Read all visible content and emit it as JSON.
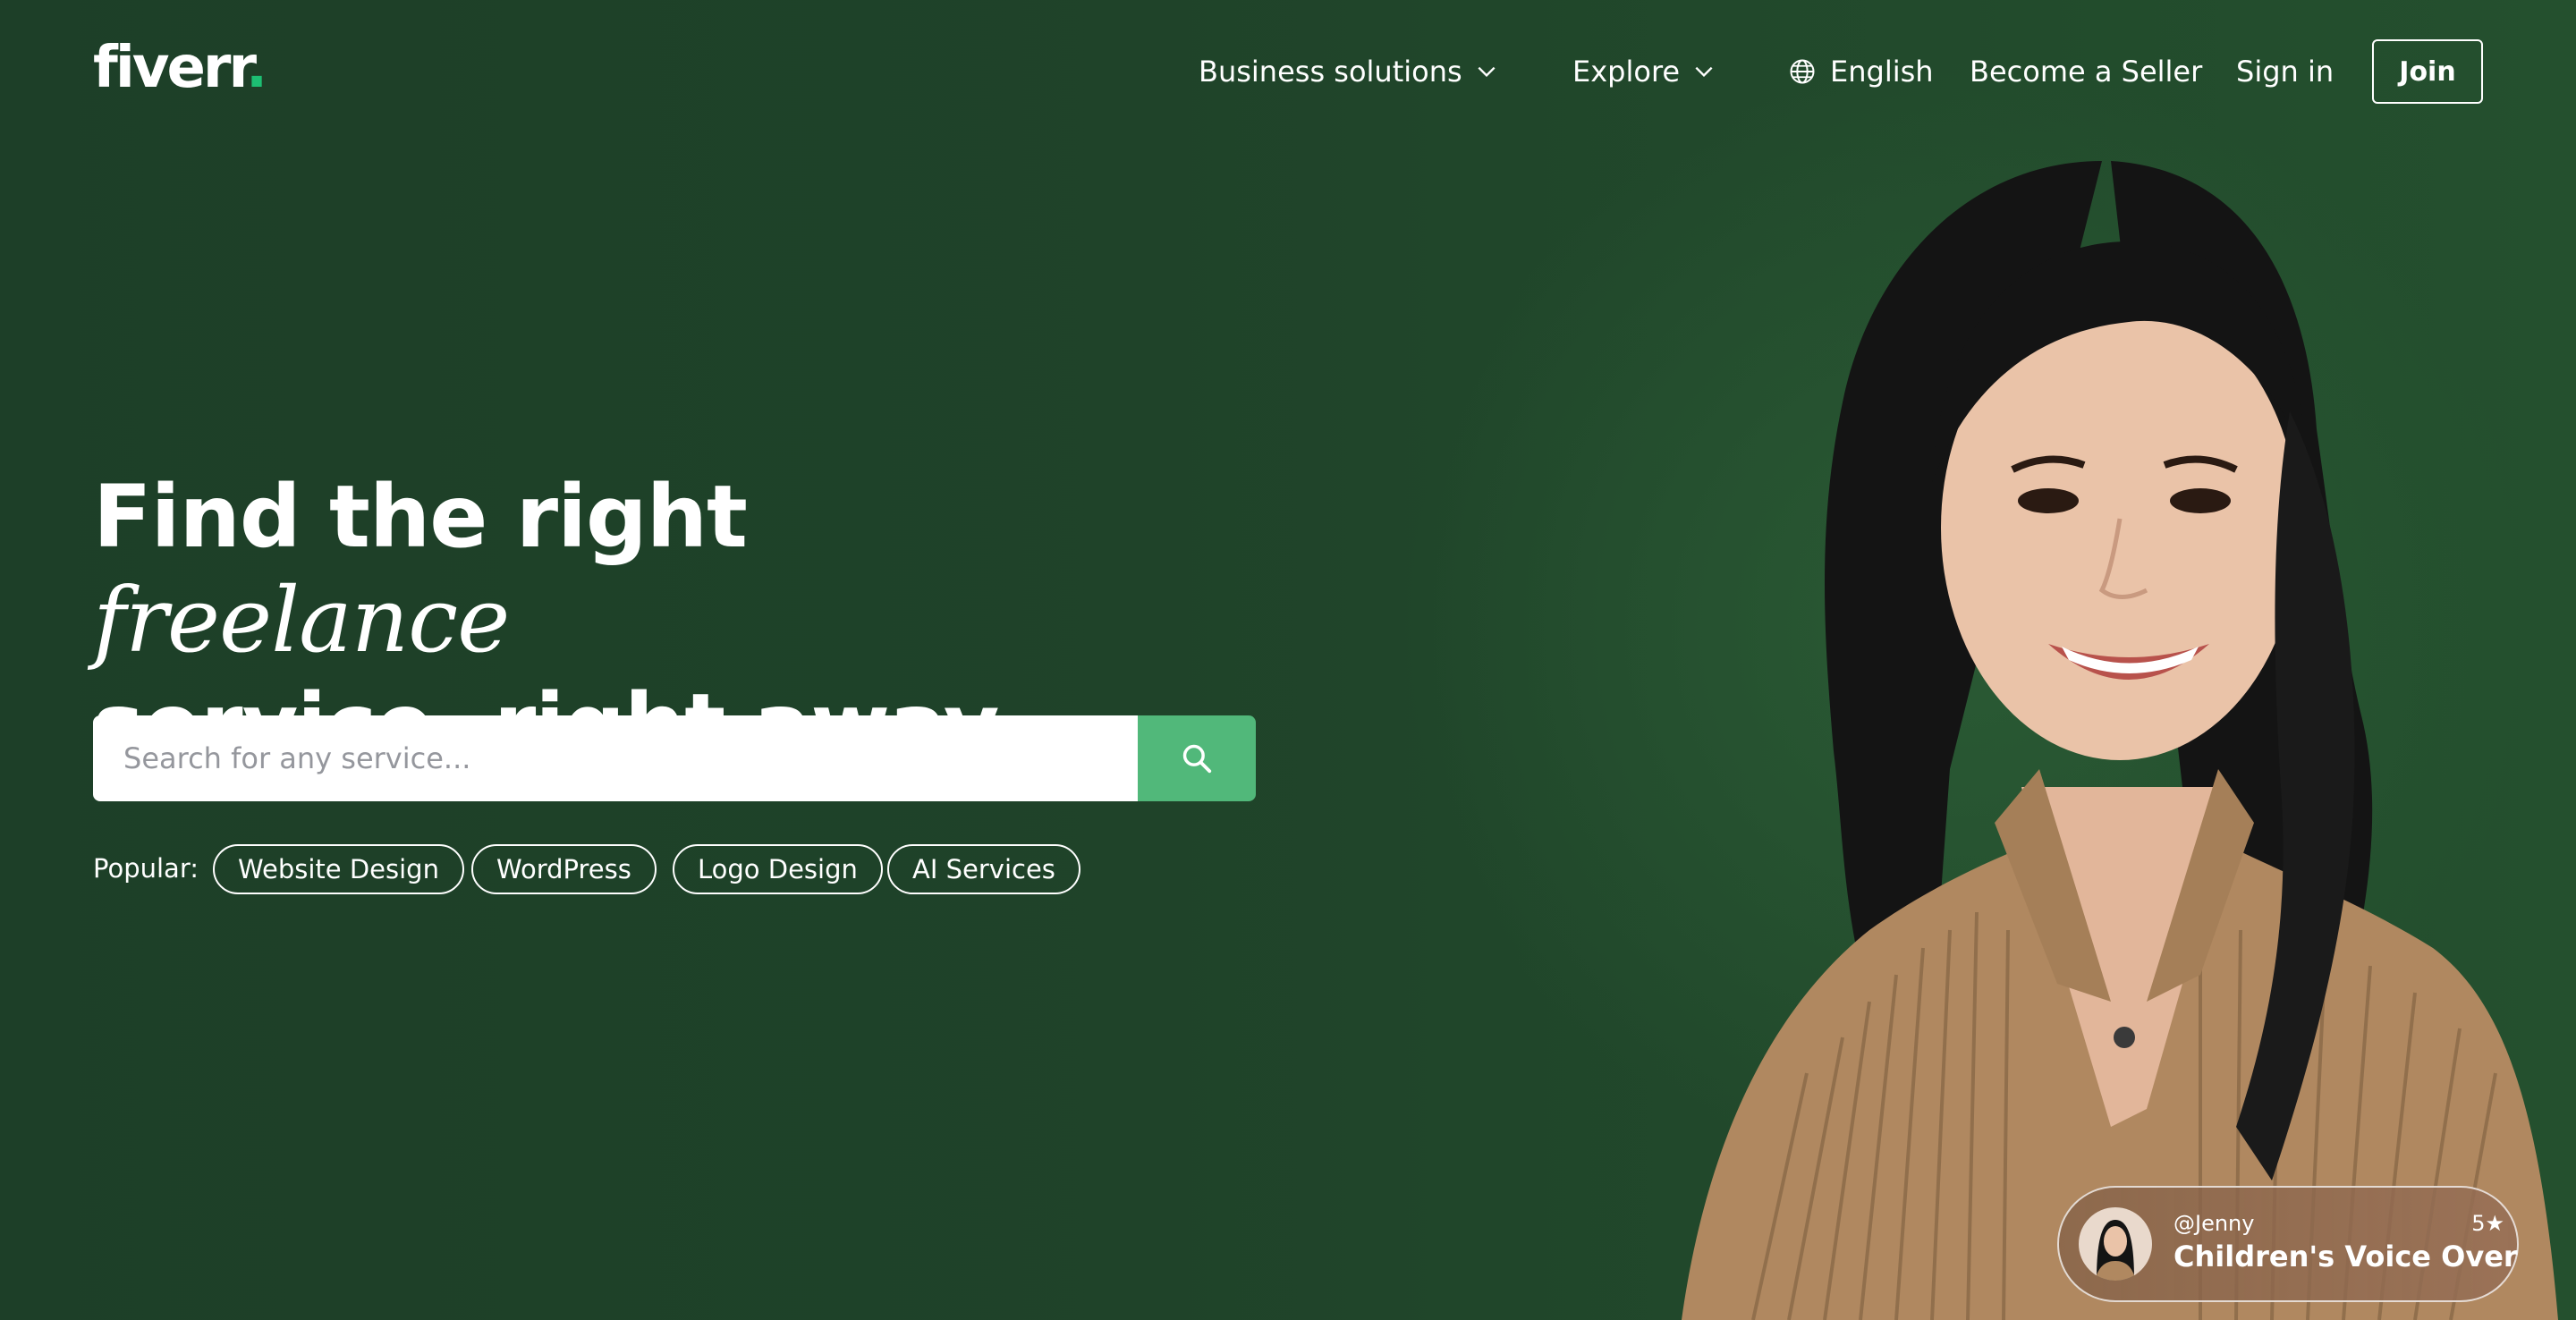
{
  "brand": {
    "logo_text": "fiverr",
    "logo_dot": ".",
    "accent_color": "#1dbf73",
    "background_color": "#1f4229"
  },
  "nav": {
    "business_solutions": "Business solutions",
    "explore": "Explore",
    "language": "English",
    "become_seller": "Become a Seller",
    "sign_in": "Sign in",
    "join": "Join"
  },
  "hero": {
    "headline_part1": "Find the right ",
    "headline_italic": "freelance",
    "headline_part2": "service, right away"
  },
  "search": {
    "placeholder": "Search for any service...",
    "value": "",
    "button_color": "#51b87a"
  },
  "popular": {
    "label": "Popular:",
    "items": [
      "Website Design",
      "WordPress",
      "Logo Design",
      "AI Services"
    ]
  },
  "seller_card": {
    "username": "@Jenny",
    "rating": "5★",
    "service": "Children's Voice Over"
  }
}
